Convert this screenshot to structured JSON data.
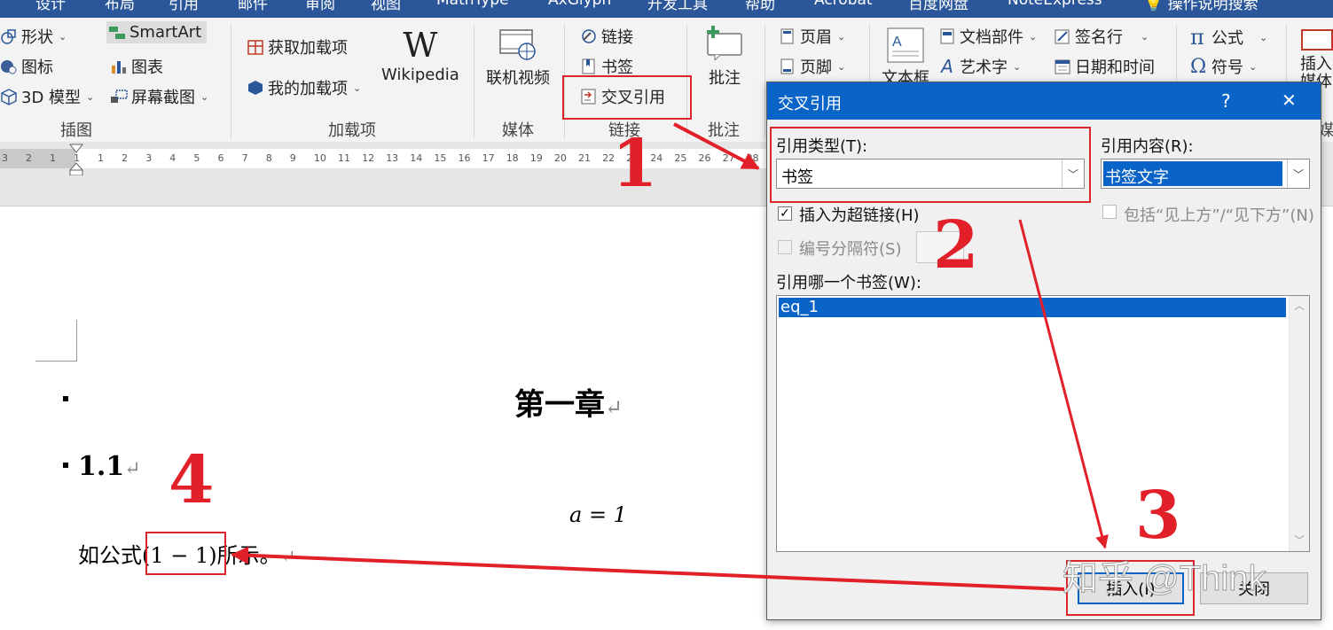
{
  "ribbon_tabs": [
    "设计",
    "布局",
    "引用",
    "邮件",
    "审阅",
    "视图",
    "MathType",
    "AxGlyph",
    "开发工具",
    "帮助",
    "Acrobat",
    "百度网盘",
    "NoteExpress",
    "操作说明搜索"
  ],
  "illustrations": {
    "shapes": "形状",
    "smartart": "SmartArt",
    "icons": "图标",
    "chart": "图表",
    "model3d": "3D 模型",
    "screenshot": "屏幕截图",
    "group": "插图"
  },
  "addins": {
    "get": "获取加载项",
    "mine": "我的加载项",
    "wikipedia": "Wikipedia",
    "group": "加载项"
  },
  "media": {
    "video": "联机视频",
    "group": "媒体"
  },
  "links": {
    "link": "链接",
    "bookmark": "书签",
    "crossref": "交叉引用",
    "group": "链接"
  },
  "comments": {
    "comment": "批注",
    "group": "批注"
  },
  "header_footer": {
    "header": "页眉",
    "footer": "页脚"
  },
  "text": {
    "textbox": "文本框",
    "parts": "文档部件",
    "wordart": "艺术字",
    "signature": "签名行",
    "datetime": "日期和时间"
  },
  "symbols": {
    "equation": "公式",
    "symbol": "符号"
  },
  "right_clip": {
    "top": "插入",
    "mid": "媒体",
    "group": "媒体"
  },
  "ruler_ticks": [
    "3",
    "2",
    "1",
    "1",
    "1",
    "2",
    "3",
    "4",
    "5",
    "6",
    "7",
    "8",
    "9",
    "10",
    "11",
    "12",
    "13",
    "14",
    "15",
    "16",
    "17",
    "18",
    "19",
    "20",
    "21",
    "22",
    "23",
    "24",
    "25",
    "26",
    "27",
    "28"
  ],
  "document": {
    "chapter": "第一章",
    "pilcrow": "↵",
    "section": "1.1",
    "equation": "a = 1",
    "para_prefix": "如公式",
    "ref": "(1 − 1)",
    "para_suffix": "所示。"
  },
  "dialog": {
    "title": "交叉引用",
    "help": "?",
    "close": "✕",
    "ref_type_label": "引用类型(T):",
    "ref_type_value": "书签",
    "ref_content_label": "引用内容(R):",
    "ref_content_value": "书签文字",
    "hyperlink_label": "插入为超链接(H)",
    "hyperlink_checked": true,
    "include_label": "包括“见上方”/“见下方”(N)",
    "separator_label": "编号分隔符(S)",
    "which_label": "引用哪一个书签(W):",
    "items": [
      "eq_1"
    ],
    "insert": "插入(I)",
    "close_btn": "关闭"
  },
  "annotations": [
    "1",
    "2",
    "3",
    "4"
  ],
  "watermark": "知乎 @Think",
  "colors": {
    "ribbon_tab": "#2b579a",
    "dialog_title": "#0a64c8",
    "selection": "#0a64c8",
    "annotation": "#e2202a"
  }
}
